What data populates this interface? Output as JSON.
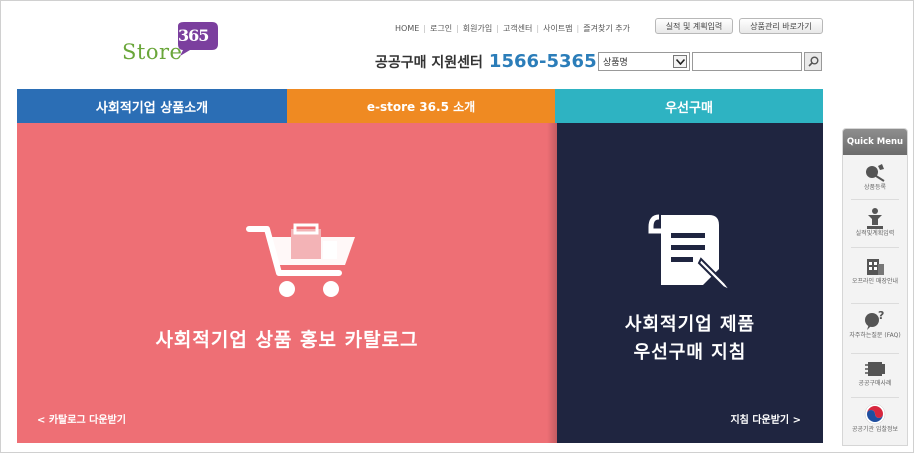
{
  "logo": {
    "text": "Store",
    "number": "365"
  },
  "topnav": {
    "items": [
      "HOME",
      "로그인",
      "회원가입",
      "고객센터",
      "사이트맵",
      "즐겨찾기 추가"
    ],
    "buttons": [
      "실적 및 계획입력",
      "상품관리 바로가기"
    ]
  },
  "support": {
    "label": "공공구매 지원센터",
    "phone": "1566-5365"
  },
  "search": {
    "select_value": "상품명",
    "query": ""
  },
  "tabs": [
    "사회적기업 상품소개",
    "e-store 36.5 소개",
    "우선구매"
  ],
  "left_panel": {
    "title": "사회적기업 상품 홍보 카탈로그",
    "link": "< 카탈로그 다운받기"
  },
  "right_panel": {
    "title_line1": "사회적기업 제품",
    "title_line2": "우선구매 지침",
    "link": "지침 다운받기 >"
  },
  "quick_menu": {
    "title": "Quick Menu",
    "items": [
      {
        "label": "상품등록",
        "icon": "product-register-icon"
      },
      {
        "label": "실적및계획입력",
        "icon": "performance-input-icon"
      },
      {
        "label": "오프라인 매장안내",
        "icon": "offline-store-icon"
      },
      {
        "label": "자주하는질문 (FAQ)",
        "icon": "faq-icon"
      },
      {
        "label": "공공구매사례",
        "icon": "purchase-case-icon"
      },
      {
        "label": "공공기관 입찰정보",
        "icon": "public-bid-icon"
      }
    ]
  },
  "colors": {
    "tab1": "#2b6eb5",
    "tab2": "#ef8a22",
    "tab3": "#2eb3c2",
    "left_panel": "#ee6f75",
    "right_panel": "#1f2540",
    "phone": "#2b7db9"
  }
}
